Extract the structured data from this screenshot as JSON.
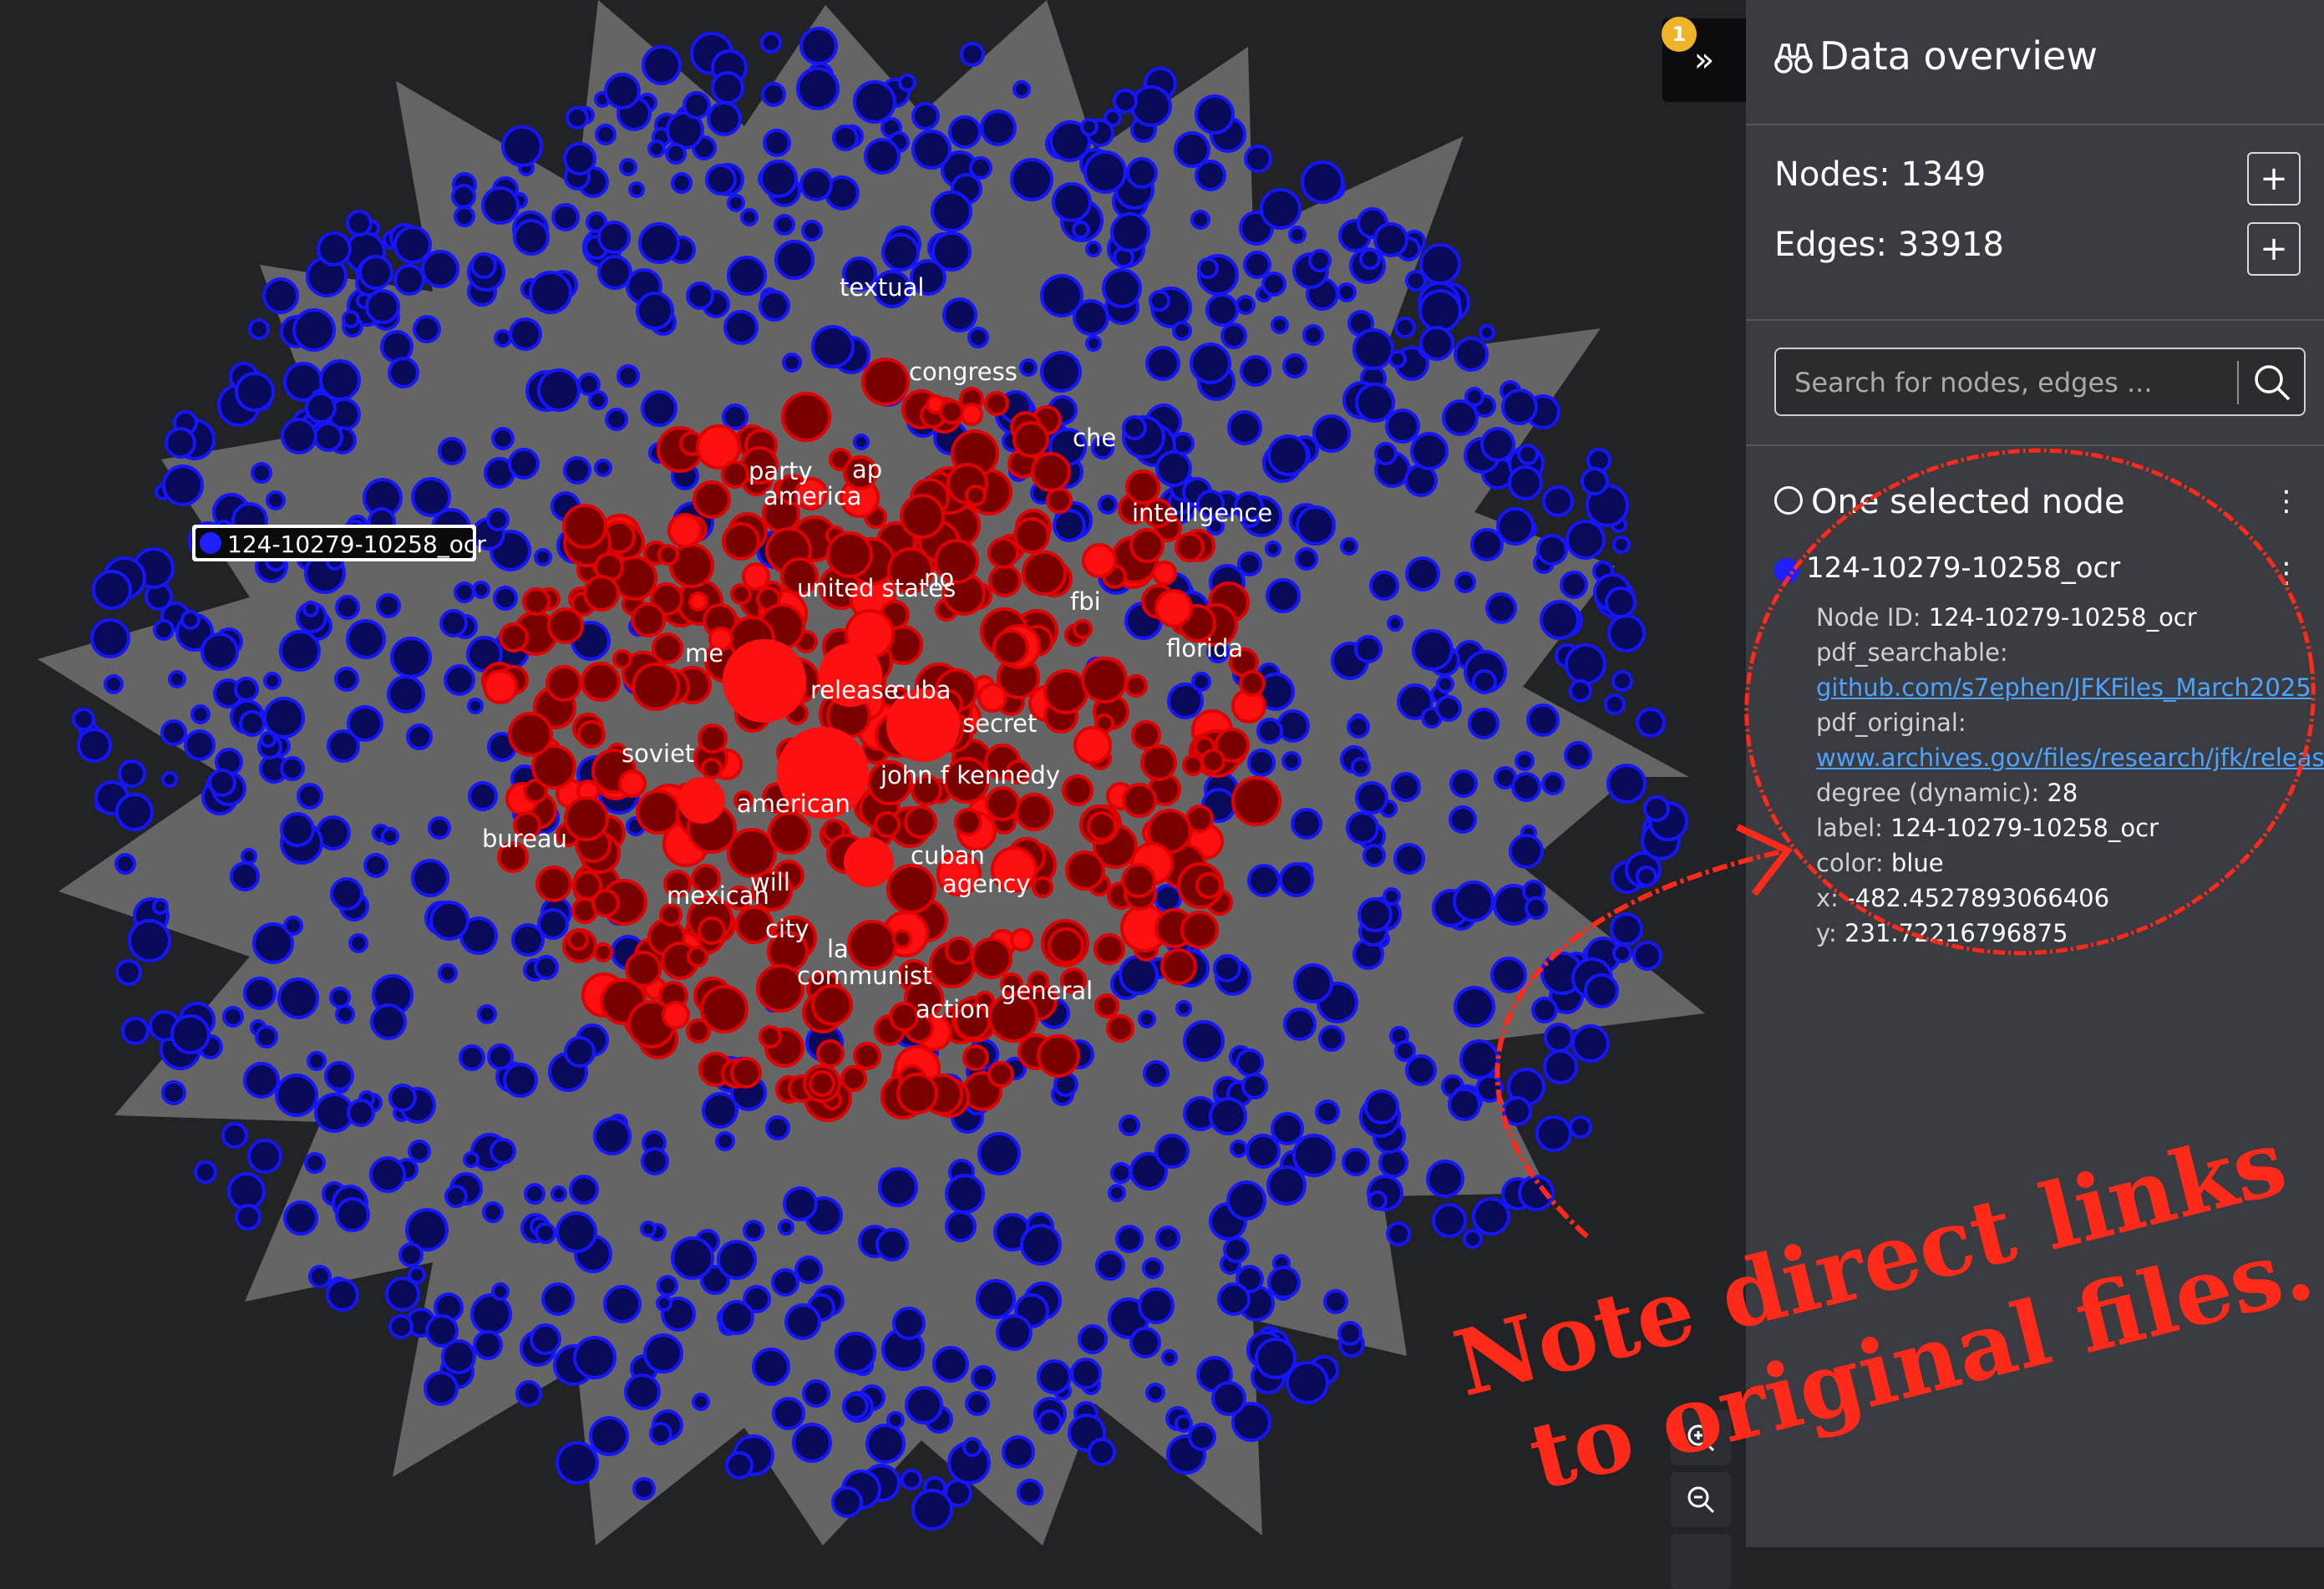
{
  "graph": {
    "selected_node_label": "124-10279-10258_ocr",
    "labels": [
      {
        "text": "textual",
        "color": "#ff2020"
      },
      {
        "text": "congress",
        "color": "#ff2020"
      },
      {
        "text": "che",
        "color": "#ff2020"
      },
      {
        "text": "party",
        "color": "#ff2020"
      },
      {
        "text": "ap",
        "color": "#ff2020"
      },
      {
        "text": "america",
        "color": "#ff2020"
      },
      {
        "text": "intelligence",
        "color": "#ff2020"
      },
      {
        "text": "no",
        "color": "#ff2020"
      },
      {
        "text": "united states",
        "color": "#ff2020"
      },
      {
        "text": "fbi",
        "color": "#ff2020"
      },
      {
        "text": "me",
        "color": "#ff2020"
      },
      {
        "text": "florida",
        "color": "#ff2020"
      },
      {
        "text": "release",
        "color": "#ff2020"
      },
      {
        "text": "cuba",
        "color": "#ff2020"
      },
      {
        "text": "secret",
        "color": "#ff2020"
      },
      {
        "text": "soviet",
        "color": "#ff2020"
      },
      {
        "text": "john f kennedy",
        "color": "#ff2020"
      },
      {
        "text": "american",
        "color": "#ff2020"
      },
      {
        "text": "bureau",
        "color": "#ff2020"
      },
      {
        "text": "cuban",
        "color": "#ff2020"
      },
      {
        "text": "agency",
        "color": "#ff2020"
      },
      {
        "text": "will",
        "color": "#ff2020"
      },
      {
        "text": "mexican",
        "color": "#ff2020"
      },
      {
        "text": "city",
        "color": "#ff2020"
      },
      {
        "text": "la",
        "color": "#ff2020"
      },
      {
        "text": "communist",
        "color": "#ff2020"
      },
      {
        "text": "general",
        "color": "#ff2020"
      },
      {
        "text": "action",
        "color": "#ff2020"
      }
    ],
    "colors": {
      "background": "#222326",
      "edge": "#6b6b6b",
      "node_blue_fill": "#0a0a5a",
      "node_blue_stroke": "#1515ff",
      "node_red_fill": "#7a0000",
      "node_red_stroke": "#e00000",
      "node_red_bright": "#ff1010"
    }
  },
  "toolbar": {
    "toggle_icon": "»",
    "badge_count": "1",
    "zoom_in_icon": "zoom-in-icon",
    "zoom_out_icon": "zoom-out-icon"
  },
  "panel": {
    "title": "Data overview",
    "title_icon": "binoculars-icon",
    "nodes_label": "Nodes: 1349",
    "edges_label": "Edges: 33918",
    "add_symbol": "+",
    "search_placeholder": "Search for nodes, edges ...",
    "selection_header": "One selected node",
    "kebab": "⋮",
    "node": {
      "name": "124-10279-10258_ocr",
      "color": "#1f1fff",
      "attributes": [
        {
          "key": "Node ID:",
          "value": "124-10279-10258_ocr"
        },
        {
          "key": "pdf_searchable:",
          "value": ""
        },
        {
          "key": "",
          "link": "github.com/s7ephen/JFKFiles_March2025"
        },
        {
          "key": "pdf_original:",
          "value": ""
        },
        {
          "key": "",
          "link": "www.archives.gov/files/research/jfk/releases"
        },
        {
          "key": "degree (dynamic):",
          "value": "28"
        },
        {
          "key": "label:",
          "value": "124-10279-10258_ocr"
        },
        {
          "key": "color:",
          "value": "blue"
        },
        {
          "key": "x:",
          "value": "-482.4527893066406"
        },
        {
          "key": "y:",
          "value": "231.72216796875"
        }
      ]
    }
  },
  "annotation": {
    "line1": "Note direct links",
    "line2": "to original files.",
    "color": "#ff2a1a"
  }
}
